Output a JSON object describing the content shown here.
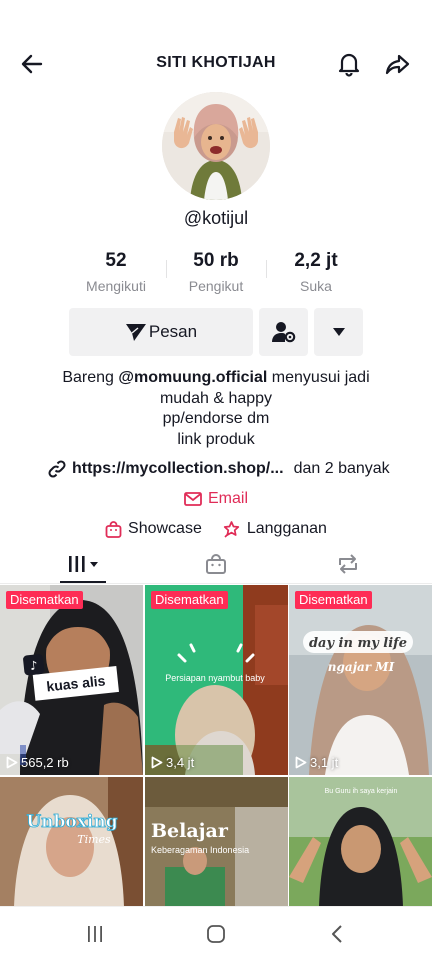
{
  "header": {
    "title": "SITI KHOTIJAH",
    "back_icon": "arrow-left-icon",
    "bell_icon": "bell-icon",
    "share_icon": "share-icon"
  },
  "profile": {
    "username": "@kotijul"
  },
  "stats": [
    {
      "value": "52",
      "label": "Mengikuti"
    },
    {
      "value": "50 rb",
      "label": "Pengikut"
    },
    {
      "value": "2,2 jt",
      "label": "Suka"
    }
  ],
  "actions": {
    "message_label": "Pesan"
  },
  "bio": {
    "line1_prefix": "Bareng ",
    "line1_mention": "@momuung.official",
    "line1_suffix": " menyusui jadi",
    "line2": "mudah & happy",
    "line3": "pp/endorse dm",
    "line4": "link produk"
  },
  "links": {
    "url": "https://mycollection.shop/...",
    "more": "dan 2 banyak",
    "email": "Email",
    "showcase": "Showcase",
    "subscription": "Langganan"
  },
  "colors": {
    "accent": "#fe2c55",
    "email": "#e02c57",
    "text": "#161823",
    "muted": "#8a8b91"
  },
  "videos": [
    {
      "pinned": "Disematkan",
      "views": "565,2 rb",
      "overlay": "kuas alis"
    },
    {
      "pinned": "Disematkan",
      "views": "3,4 jt",
      "overlay": "Persiapan nyambut baby"
    },
    {
      "pinned": "Disematkan",
      "views": "3,1 jt",
      "overlay1": "day in my life",
      "overlay2": "ngajar MI"
    },
    {
      "overlay1": "Unboxing",
      "overlay2": "Times"
    },
    {
      "overlay1": "Belajar",
      "overlay2": "Keberagaman Indonesia"
    },
    {
      "overlay": "Bu Guru ih saya kerjain"
    }
  ]
}
